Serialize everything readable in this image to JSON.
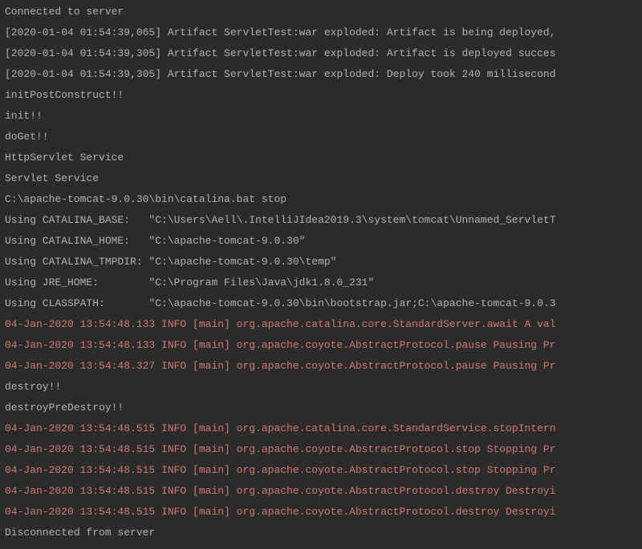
{
  "lines": [
    {
      "text": "Connected to server",
      "cls": ""
    },
    {
      "text": "[2020-01-04 01:54:39,065] Artifact ServletTest:war exploded: Artifact is being deployed,",
      "cls": ""
    },
    {
      "text": "[2020-01-04 01:54:39,305] Artifact ServletTest:war exploded: Artifact is deployed succes",
      "cls": ""
    },
    {
      "text": "[2020-01-04 01:54:39,305] Artifact ServletTest:war exploded: Deploy took 240 millisecond",
      "cls": ""
    },
    {
      "text": "initPostConstruct!!",
      "cls": ""
    },
    {
      "text": "init!!",
      "cls": ""
    },
    {
      "text": "doGet!!",
      "cls": ""
    },
    {
      "text": "HttpServlet Service",
      "cls": ""
    },
    {
      "text": "Servlet Service",
      "cls": ""
    },
    {
      "text": "C:\\apache-tomcat-9.0.30\\bin\\catalina.bat stop",
      "cls": ""
    },
    {
      "text": "Using CATALINA_BASE:   \"C:\\Users\\Aell\\.IntelliJIdea2019.3\\system\\tomcat\\Unnamed_ServletT",
      "cls": ""
    },
    {
      "text": "Using CATALINA_HOME:   \"C:\\apache-tomcat-9.0.30\"",
      "cls": ""
    },
    {
      "text": "Using CATALINA_TMPDIR: \"C:\\apache-tomcat-9.0.30\\temp\"",
      "cls": ""
    },
    {
      "text": "Using JRE_HOME:        \"C:\\Program Files\\Java\\jdk1.8.0_231\"",
      "cls": ""
    },
    {
      "text": "Using CLASSPATH:       \"C:\\apache-tomcat-9.0.30\\bin\\bootstrap.jar;C:\\apache-tomcat-9.0.3",
      "cls": ""
    },
    {
      "text": "04-Jan-2020 13:54:48.133 INFO [main] org.apache.catalina.core.StandardServer.await A val",
      "cls": "err"
    },
    {
      "text": "04-Jan-2020 13:54:48.133 INFO [main] org.apache.coyote.AbstractProtocol.pause Pausing Pr",
      "cls": "err"
    },
    {
      "text": "04-Jan-2020 13:54:48.327 INFO [main] org.apache.coyote.AbstractProtocol.pause Pausing Pr",
      "cls": "err"
    },
    {
      "text": "destroy!!",
      "cls": ""
    },
    {
      "text": "destroyPreDestroy!!",
      "cls": ""
    },
    {
      "text": "04-Jan-2020 13:54:48.515 INFO [main] org.apache.catalina.core.StandardService.stopIntern",
      "cls": "err"
    },
    {
      "text": "04-Jan-2020 13:54:48.515 INFO [main] org.apache.coyote.AbstractProtocol.stop Stopping Pr",
      "cls": "err"
    },
    {
      "text": "04-Jan-2020 13:54:48.515 INFO [main] org.apache.coyote.AbstractProtocol.stop Stopping Pr",
      "cls": "err"
    },
    {
      "text": "04-Jan-2020 13:54:48.515 INFO [main] org.apache.coyote.AbstractProtocol.destroy Destroyi",
      "cls": "err"
    },
    {
      "text": "04-Jan-2020 13:54:48.515 INFO [main] org.apache.coyote.AbstractProtocol.destroy Destroyi",
      "cls": "err"
    },
    {
      "text": "Disconnected from server",
      "cls": ""
    }
  ]
}
